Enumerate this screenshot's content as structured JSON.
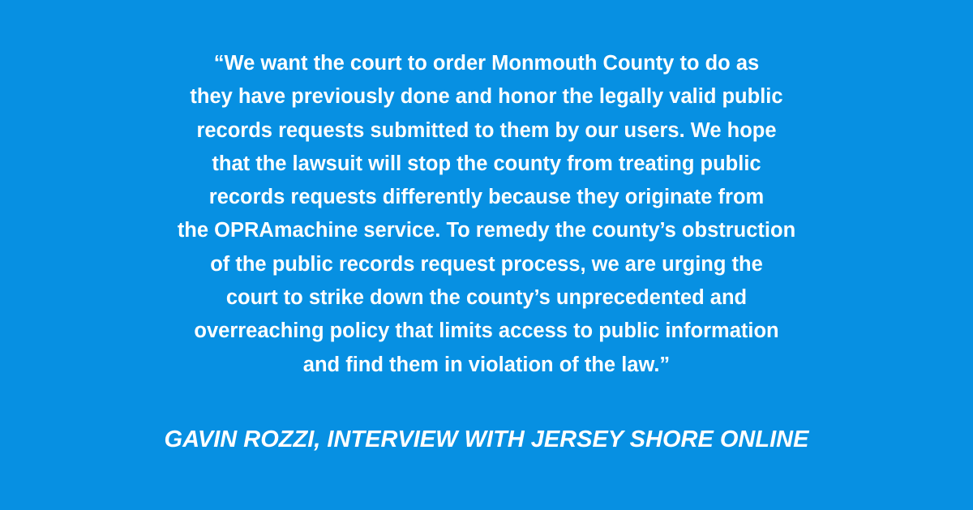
{
  "quote": {
    "lines": [
      "“We want the court to order Monmouth County to do as",
      "they have previously done and honor the legally valid public",
      "records requests submitted to them by our users. We hope",
      "that the lawsuit will stop the county from treating public",
      "records requests differently because they originate from",
      "the OPRAmachine service. To remedy the county’s obstruction",
      "of the public records request process, we are urging the",
      "court to strike down the county’s unprecedented and",
      "overreaching policy that limits access to public information",
      "and find them in violation of the law.”"
    ]
  },
  "attribution": "GAVIN ROZZI, INTERVIEW WITH JERSEY SHORE ONLINE",
  "colors": {
    "background": "#0790e2",
    "text": "#ffffff"
  }
}
